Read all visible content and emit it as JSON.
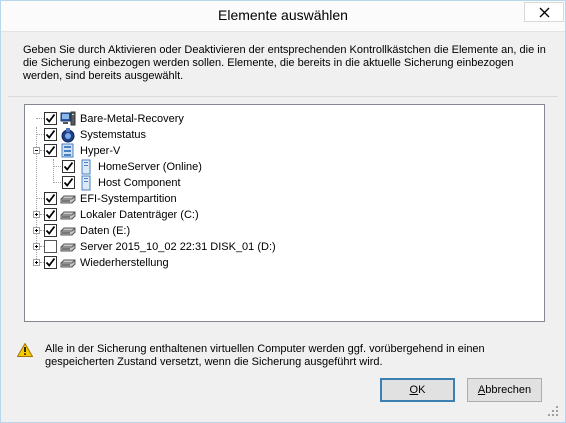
{
  "window": {
    "title": "Elemente auswählen"
  },
  "description": "Geben Sie durch Aktivieren oder Deaktivieren der entsprechenden Kontrollkästchen die Elemente an, die in die Sicherung einbezogen werden sollen. Elemente, die bereits in die aktuelle Sicherung einbezogen werden, sind bereits ausgewählt.",
  "tree": {
    "items": [
      {
        "label": "Bare-Metal-Recovery",
        "checked": true,
        "icon": "computer-icon"
      },
      {
        "label": "Systemstatus",
        "checked": true,
        "icon": "system-state-icon"
      },
      {
        "label": "Hyper-V",
        "checked": true,
        "icon": "hyperv-icon",
        "expanded": true
      },
      {
        "label": "HomeServer (Online)",
        "checked": true,
        "icon": "vm-icon"
      },
      {
        "label": "Host Component",
        "checked": true,
        "icon": "vm-icon"
      },
      {
        "label": "EFI-Systempartition",
        "checked": true,
        "icon": "drive-icon"
      },
      {
        "label": "Lokaler Datenträger (C:)",
        "checked": true,
        "icon": "drive-icon",
        "expanded": false
      },
      {
        "label": "Daten (E:)",
        "checked": true,
        "icon": "drive-icon",
        "expanded": false
      },
      {
        "label": "Server 2015_10_02 22:31 DISK_01 (D:)",
        "checked": false,
        "icon": "drive-icon",
        "expanded": false
      },
      {
        "label": "Wiederherstellung",
        "checked": true,
        "icon": "drive-icon",
        "expanded": false
      }
    ]
  },
  "warning": "Alle in der Sicherung enthaltenen virtuellen Computer werden ggf. vorübergehend in einen gespeicherten Zustand versetzt, wenn die Sicherung ausgeführt wird.",
  "buttons": {
    "ok": {
      "mnemonic": "O",
      "rest": "K"
    },
    "cancel": {
      "mnemonic": "A",
      "rest": "bbrechen"
    }
  }
}
